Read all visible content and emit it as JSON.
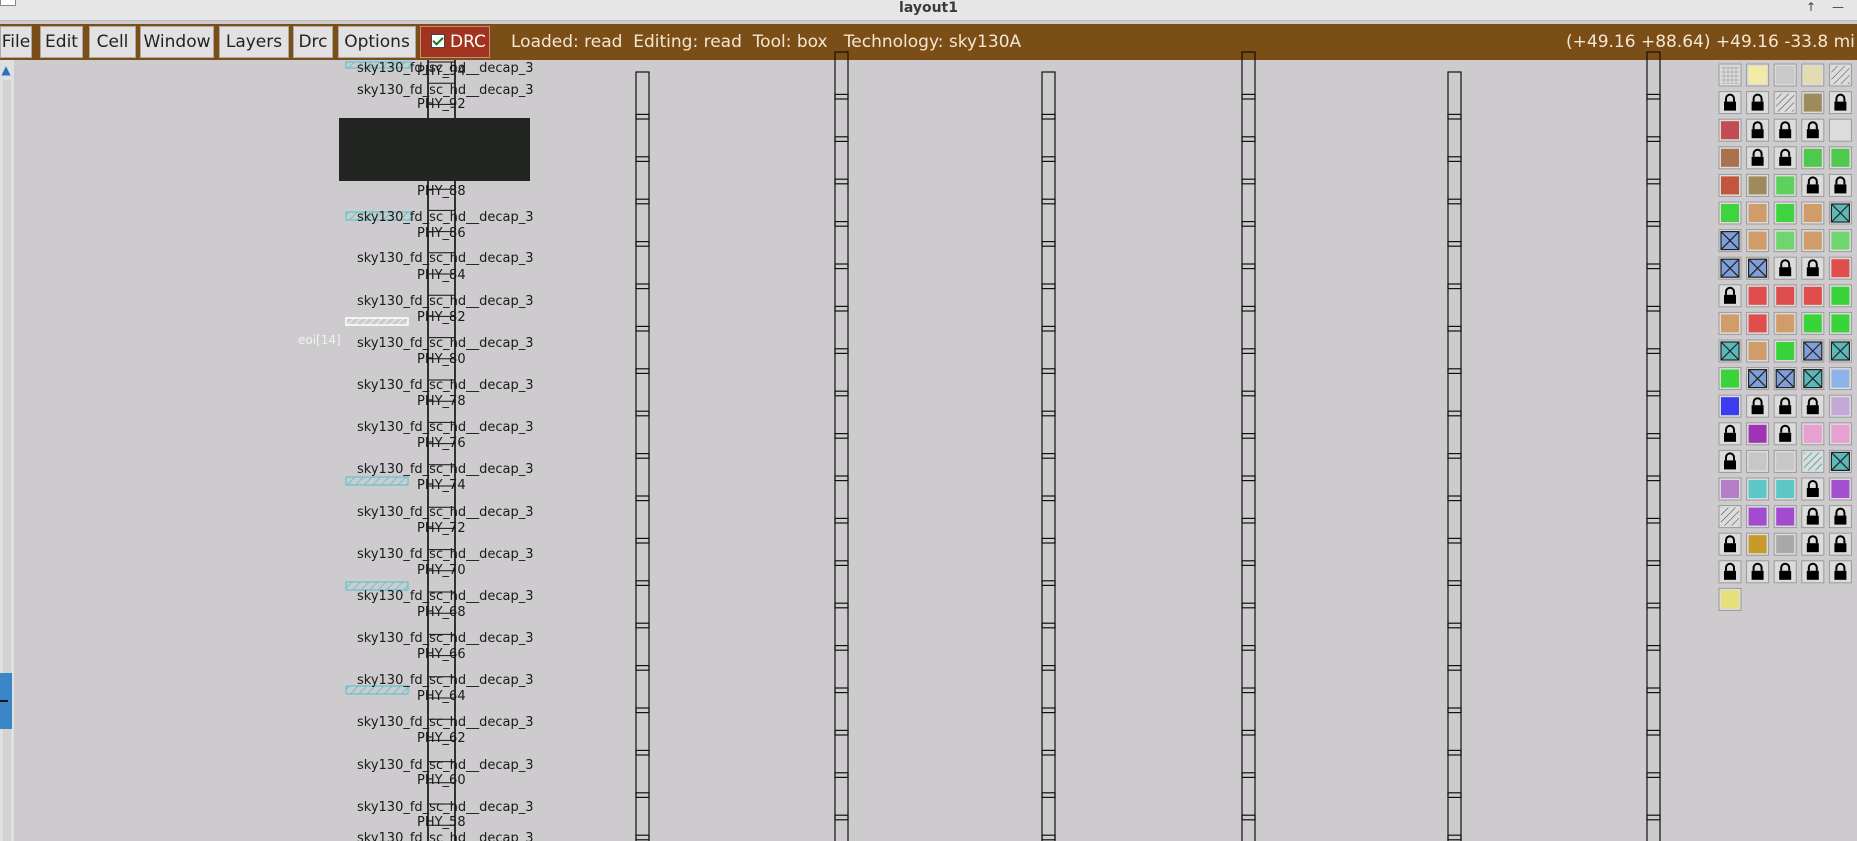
{
  "window": {
    "title": "layout1"
  },
  "menu": [
    {
      "label": "File"
    },
    {
      "label": "Edit"
    },
    {
      "label": "Cell"
    },
    {
      "label": "Window"
    },
    {
      "label": "Layers"
    },
    {
      "label": "Drc"
    },
    {
      "label": "Options"
    }
  ],
  "drc": {
    "label": "DRC",
    "checked": true
  },
  "status": "Loaded: read  Editing: read  Tool: box   Technology: sky130A",
  "coords": "(+49.16 +88.64) +49.16 -33.8 mi",
  "canvas": {
    "pin_label": "eoi[14]",
    "cells": [
      {
        "name": "sky130_fd_sc_hd__decap_3",
        "inst": "PHY_94"
      },
      {
        "name": "sky130_fd_sc_hd__decap_3",
        "inst": "PHY_92"
      },
      {
        "name": "",
        "inst": "PHY_88"
      },
      {
        "name": "sky130_fd_sc_hd__decap_3",
        "inst": "PHY_86"
      },
      {
        "name": "sky130_fd_sc_hd__decap_3",
        "inst": "PHY_84"
      },
      {
        "name": "sky130_fd_sc_hd__decap_3",
        "inst": "PHY_82"
      },
      {
        "name": "sky130_fd_sc_hd__decap_3",
        "inst": "PHY_80"
      },
      {
        "name": "sky130_fd_sc_hd__decap_3",
        "inst": "PHY_78"
      },
      {
        "name": "sky130_fd_sc_hd__decap_3",
        "inst": "PHY_76"
      },
      {
        "name": "sky130_fd_sc_hd__decap_3",
        "inst": "PHY_74"
      },
      {
        "name": "sky130_fd_sc_hd__decap_3",
        "inst": "PHY_72"
      },
      {
        "name": "sky130_fd_sc_hd__decap_3",
        "inst": "PHY_70"
      },
      {
        "name": "sky130_fd_sc_hd__decap_3",
        "inst": "PHY_68"
      },
      {
        "name": "sky130_fd_sc_hd__decap_3",
        "inst": "PHY_66"
      },
      {
        "name": "sky130_fd_sc_hd__decap_3",
        "inst": "PHY_64"
      },
      {
        "name": "sky130_fd_sc_hd__decap_3",
        "inst": "PHY_62"
      },
      {
        "name": "sky130_fd_sc_hd__decap_3",
        "inst": "PHY_60"
      },
      {
        "name": "sky130_fd_sc_hd__decap_3",
        "inst": "PHY_58"
      },
      {
        "name": "sky130_fd_sc_hd__decap_3",
        "inst": ""
      }
    ]
  },
  "palette": {
    "rows": [
      [
        "grid",
        "#f2eaa6",
        "#c9c9c9",
        "#e2dcb0",
        "stripe-gray"
      ],
      [
        "lock",
        "lock",
        "stripe-gray",
        "#9f8a5e",
        "lock"
      ],
      [
        "#c14d52",
        "lock",
        "lock",
        "lock",
        "#dcdcdc"
      ],
      [
        "#a9714d",
        "lock",
        "lock",
        "#4ec94e",
        "#4ec94e"
      ],
      [
        "#c2553a",
        "#9f8a5e",
        "#5dd15d",
        "lock",
        "lock"
      ],
      [
        "#3fd33f",
        "#d09c6a",
        "#3fd33f",
        "#d09c6a",
        "x-teal"
      ],
      [
        "x-blue",
        "#d09c6a",
        "#6fd66f",
        "#d09c6a",
        "#6fd66f"
      ],
      [
        "x-blue",
        "x-blue",
        "lock",
        "lock",
        "#e04d4d"
      ],
      [
        "lock",
        "#e04d4d",
        "#e04d4d",
        "#e04d4d",
        "#39d439"
      ],
      [
        "#d09c6a",
        "#e04d4d",
        "#d09c6a",
        "#39d439",
        "#39d439"
      ],
      [
        "x-teal",
        "#d09c6a",
        "#39d439",
        "x-blue",
        "x-teal"
      ],
      [
        "#39d439",
        "x-blue",
        "x-blue",
        "x-teal",
        "#8fb3e8"
      ],
      [
        "#3b3bf0",
        "lock",
        "lock",
        "lock",
        "#c4a9d6"
      ],
      [
        "lock",
        "#a033b3",
        "lock",
        "#e7a0d0",
        "#e7a0d0"
      ],
      [
        "lock",
        "#c7c7c7",
        "#c7c7c7",
        "stripe-teal",
        "x-teal"
      ],
      [
        "#b47fc7",
        "#5cc7c7",
        "#5cc7c7",
        "lock",
        "#a550d0"
      ],
      [
        "stripe-gray",
        "#a24ad0",
        "#a24ad0",
        "lock",
        "lock"
      ],
      [
        "lock",
        "#c99a2a",
        "#a9a9a9",
        "lock",
        "lock"
      ],
      [
        "lock",
        "lock",
        "lock",
        "lock",
        "lock"
      ],
      [
        "#e6df7a"
      ]
    ]
  }
}
